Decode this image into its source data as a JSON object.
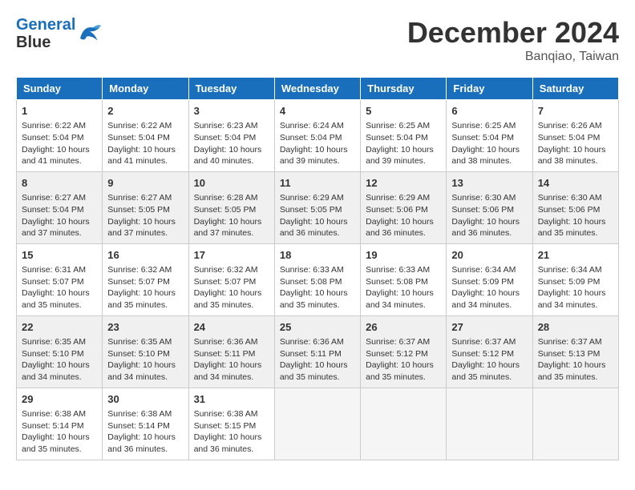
{
  "logo": {
    "line1": "General",
    "line2": "Blue"
  },
  "title": "December 2024",
  "location": "Banqiao, Taiwan",
  "weekdays": [
    "Sunday",
    "Monday",
    "Tuesday",
    "Wednesday",
    "Thursday",
    "Friday",
    "Saturday"
  ],
  "weeks": [
    [
      {
        "day": 1,
        "sunrise": "6:22 AM",
        "sunset": "5:04 PM",
        "daylight": "10 hours and 41 minutes."
      },
      {
        "day": 2,
        "sunrise": "6:22 AM",
        "sunset": "5:04 PM",
        "daylight": "10 hours and 41 minutes."
      },
      {
        "day": 3,
        "sunrise": "6:23 AM",
        "sunset": "5:04 PM",
        "daylight": "10 hours and 40 minutes."
      },
      {
        "day": 4,
        "sunrise": "6:24 AM",
        "sunset": "5:04 PM",
        "daylight": "10 hours and 39 minutes."
      },
      {
        "day": 5,
        "sunrise": "6:25 AM",
        "sunset": "5:04 PM",
        "daylight": "10 hours and 39 minutes."
      },
      {
        "day": 6,
        "sunrise": "6:25 AM",
        "sunset": "5:04 PM",
        "daylight": "10 hours and 38 minutes."
      },
      {
        "day": 7,
        "sunrise": "6:26 AM",
        "sunset": "5:04 PM",
        "daylight": "10 hours and 38 minutes."
      }
    ],
    [
      {
        "day": 8,
        "sunrise": "6:27 AM",
        "sunset": "5:04 PM",
        "daylight": "10 hours and 37 minutes."
      },
      {
        "day": 9,
        "sunrise": "6:27 AM",
        "sunset": "5:05 PM",
        "daylight": "10 hours and 37 minutes."
      },
      {
        "day": 10,
        "sunrise": "6:28 AM",
        "sunset": "5:05 PM",
        "daylight": "10 hours and 37 minutes."
      },
      {
        "day": 11,
        "sunrise": "6:29 AM",
        "sunset": "5:05 PM",
        "daylight": "10 hours and 36 minutes."
      },
      {
        "day": 12,
        "sunrise": "6:29 AM",
        "sunset": "5:06 PM",
        "daylight": "10 hours and 36 minutes."
      },
      {
        "day": 13,
        "sunrise": "6:30 AM",
        "sunset": "5:06 PM",
        "daylight": "10 hours and 36 minutes."
      },
      {
        "day": 14,
        "sunrise": "6:30 AM",
        "sunset": "5:06 PM",
        "daylight": "10 hours and 35 minutes."
      }
    ],
    [
      {
        "day": 15,
        "sunrise": "6:31 AM",
        "sunset": "5:07 PM",
        "daylight": "10 hours and 35 minutes."
      },
      {
        "day": 16,
        "sunrise": "6:32 AM",
        "sunset": "5:07 PM",
        "daylight": "10 hours and 35 minutes."
      },
      {
        "day": 17,
        "sunrise": "6:32 AM",
        "sunset": "5:07 PM",
        "daylight": "10 hours and 35 minutes."
      },
      {
        "day": 18,
        "sunrise": "6:33 AM",
        "sunset": "5:08 PM",
        "daylight": "10 hours and 35 minutes."
      },
      {
        "day": 19,
        "sunrise": "6:33 AM",
        "sunset": "5:08 PM",
        "daylight": "10 hours and 34 minutes."
      },
      {
        "day": 20,
        "sunrise": "6:34 AM",
        "sunset": "5:09 PM",
        "daylight": "10 hours and 34 minutes."
      },
      {
        "day": 21,
        "sunrise": "6:34 AM",
        "sunset": "5:09 PM",
        "daylight": "10 hours and 34 minutes."
      }
    ],
    [
      {
        "day": 22,
        "sunrise": "6:35 AM",
        "sunset": "5:10 PM",
        "daylight": "10 hours and 34 minutes."
      },
      {
        "day": 23,
        "sunrise": "6:35 AM",
        "sunset": "5:10 PM",
        "daylight": "10 hours and 34 minutes."
      },
      {
        "day": 24,
        "sunrise": "6:36 AM",
        "sunset": "5:11 PM",
        "daylight": "10 hours and 34 minutes."
      },
      {
        "day": 25,
        "sunrise": "6:36 AM",
        "sunset": "5:11 PM",
        "daylight": "10 hours and 35 minutes."
      },
      {
        "day": 26,
        "sunrise": "6:37 AM",
        "sunset": "5:12 PM",
        "daylight": "10 hours and 35 minutes."
      },
      {
        "day": 27,
        "sunrise": "6:37 AM",
        "sunset": "5:12 PM",
        "daylight": "10 hours and 35 minutes."
      },
      {
        "day": 28,
        "sunrise": "6:37 AM",
        "sunset": "5:13 PM",
        "daylight": "10 hours and 35 minutes."
      }
    ],
    [
      {
        "day": 29,
        "sunrise": "6:38 AM",
        "sunset": "5:14 PM",
        "daylight": "10 hours and 35 minutes."
      },
      {
        "day": 30,
        "sunrise": "6:38 AM",
        "sunset": "5:14 PM",
        "daylight": "10 hours and 36 minutes."
      },
      {
        "day": 31,
        "sunrise": "6:38 AM",
        "sunset": "5:15 PM",
        "daylight": "10 hours and 36 minutes."
      },
      null,
      null,
      null,
      null
    ]
  ]
}
